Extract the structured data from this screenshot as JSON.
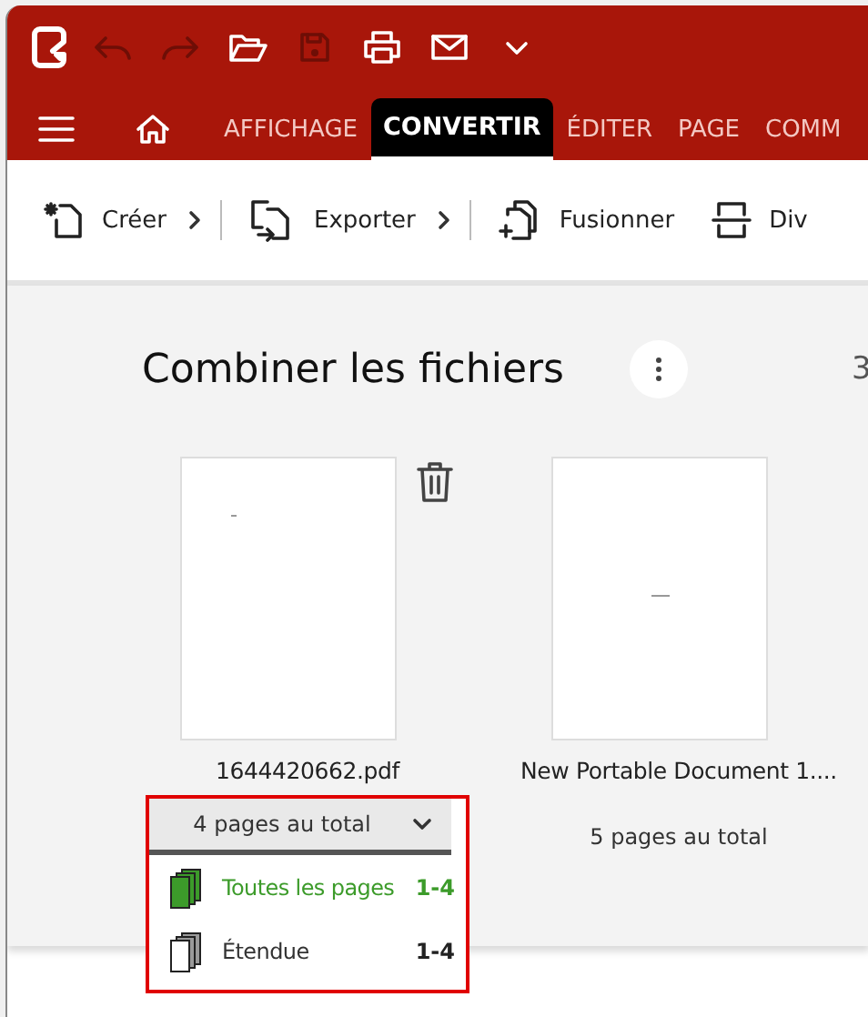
{
  "title_bar": {
    "buttons": [
      {
        "kind": "logo",
        "disabled": false
      },
      {
        "kind": "undo",
        "disabled": true
      },
      {
        "kind": "redo",
        "disabled": true
      },
      {
        "kind": "open",
        "disabled": false
      },
      {
        "kind": "save",
        "disabled": true
      },
      {
        "kind": "print",
        "disabled": false
      },
      {
        "kind": "mail",
        "disabled": false
      },
      {
        "kind": "more",
        "disabled": false
      }
    ]
  },
  "tabs": [
    {
      "kind": "menu",
      "selected": false
    },
    {
      "kind": "home",
      "selected": false
    },
    {
      "kind": "text",
      "label": "AFFICHAGE",
      "selected": false
    },
    {
      "kind": "text",
      "label": "CONVERTIR",
      "selected": true
    },
    {
      "kind": "text",
      "label": "ÉDITER",
      "selected": false
    },
    {
      "kind": "text",
      "label": "PAGE",
      "selected": false
    },
    {
      "kind": "text",
      "label": "COMM",
      "selected": false
    }
  ],
  "ribbon": {
    "items": [
      {
        "kind": "create",
        "label": "Créer",
        "submenu": true
      },
      {
        "kind": "export",
        "label": "Exporter",
        "submenu": true
      },
      {
        "kind": "merge",
        "label": "Fusionner",
        "submenu": false
      },
      {
        "kind": "split",
        "label": "Div",
        "submenu": false
      }
    ]
  },
  "panel": {
    "title": "Combiner les fichiers",
    "count": "3",
    "files": [
      {
        "name": "1644420662.pdf",
        "pages": "4 pages au total",
        "dropdown": true,
        "deletable": true,
        "menu": [
          {
            "label": "Toutes les pages",
            "range": "1-4",
            "selected": true
          },
          {
            "label": "Étendue",
            "range": "1-4",
            "selected": false
          }
        ]
      },
      {
        "name": "New Portable Document 1....",
        "pages": "5 pages au total",
        "dropdown": false,
        "deletable": false
      }
    ]
  }
}
